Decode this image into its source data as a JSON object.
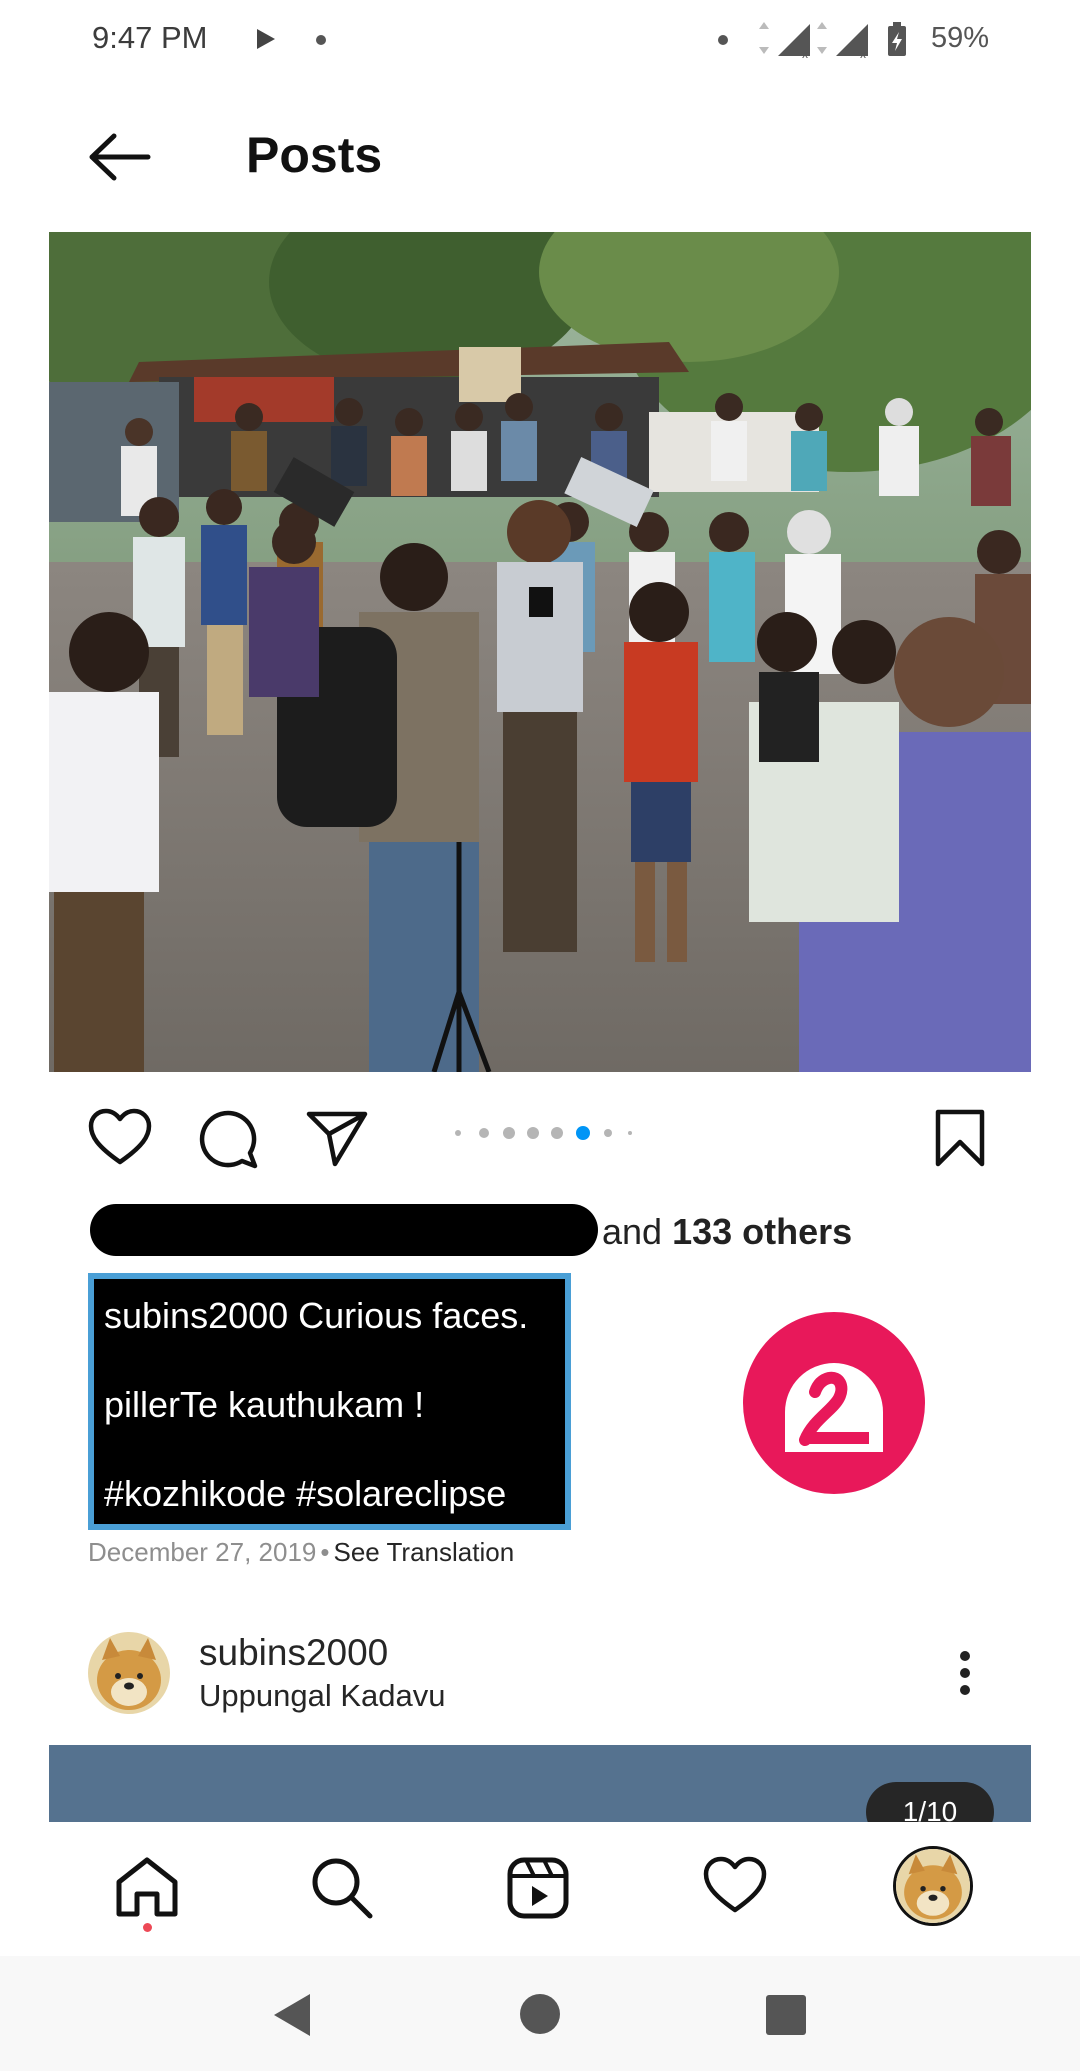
{
  "status_bar": {
    "time": "9:47 PM",
    "battery": "59%"
  },
  "header": {
    "title": "Posts"
  },
  "post": {
    "likes": {
      "count_text": "133 others",
      "prefix": "and"
    },
    "carousel": {
      "total_dots": 8,
      "active_index": 5
    },
    "caption": {
      "line1": "subins2000 Curious faces.",
      "line2": "pillerTe kauthukam !",
      "line3": "#kozhikode #solareclipse"
    },
    "date": "December 27, 2019",
    "separator": "•",
    "see_translation": "See Translation"
  },
  "next_post": {
    "username": "subins2000",
    "location": "Uppungal Kadavu",
    "counter": "1/10"
  },
  "colors": {
    "accent_blue": "#0095f6",
    "like_red": "#ed4956",
    "caption_border": "#4a9fd6",
    "logo_pink": "#e8185a"
  },
  "icons": {
    "back": "back-arrow-icon",
    "like": "heart-icon",
    "comment": "comment-icon",
    "share": "paper-plane-icon",
    "save": "bookmark-icon",
    "more": "more-vertical-icon",
    "nav": [
      "home-icon",
      "search-icon",
      "reels-icon",
      "heart-icon",
      "profile-avatar"
    ]
  }
}
